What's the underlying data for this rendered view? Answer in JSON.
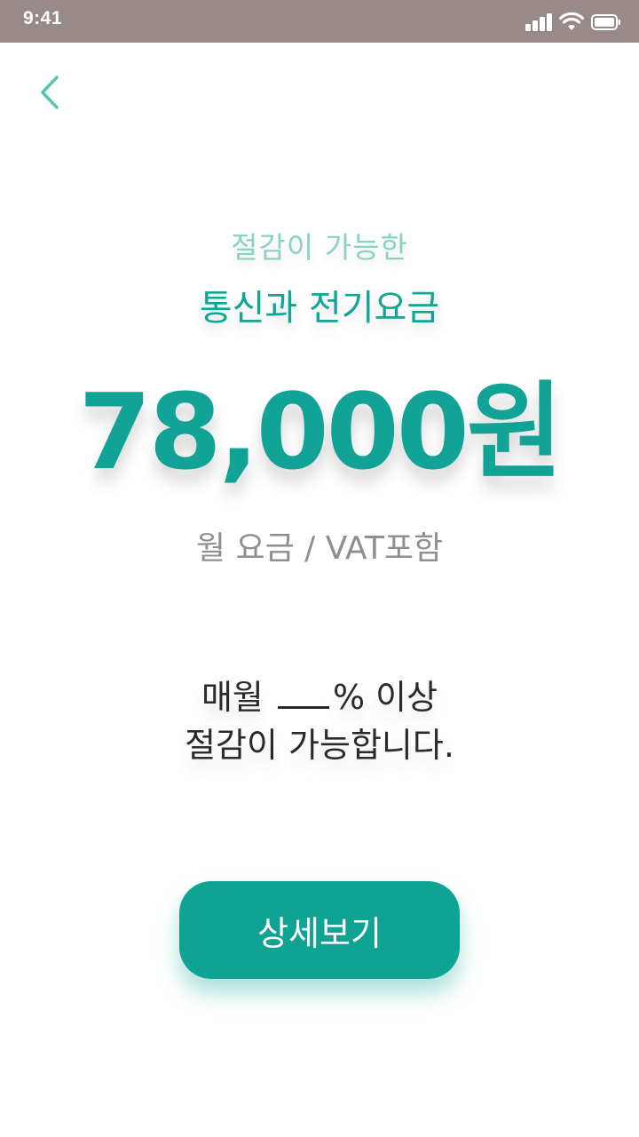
{
  "status_bar": {
    "time": "9:41"
  },
  "header": {
    "back_icon": "chevron-left-icon"
  },
  "hero": {
    "subtitle": "절감이 가능한",
    "title": "통신과 전기요금",
    "price": "78,000원",
    "price_note": "월 요금 / VAT포함"
  },
  "saving": {
    "line1_prefix": "매월",
    "line1_suffix": "% 이상",
    "line2": "절감이 가능합니다."
  },
  "cta": {
    "label": "상세보기"
  },
  "colors": {
    "accent": "#0fa393",
    "accent_light": "#8ad2c6",
    "status_bar": "#978a88"
  }
}
